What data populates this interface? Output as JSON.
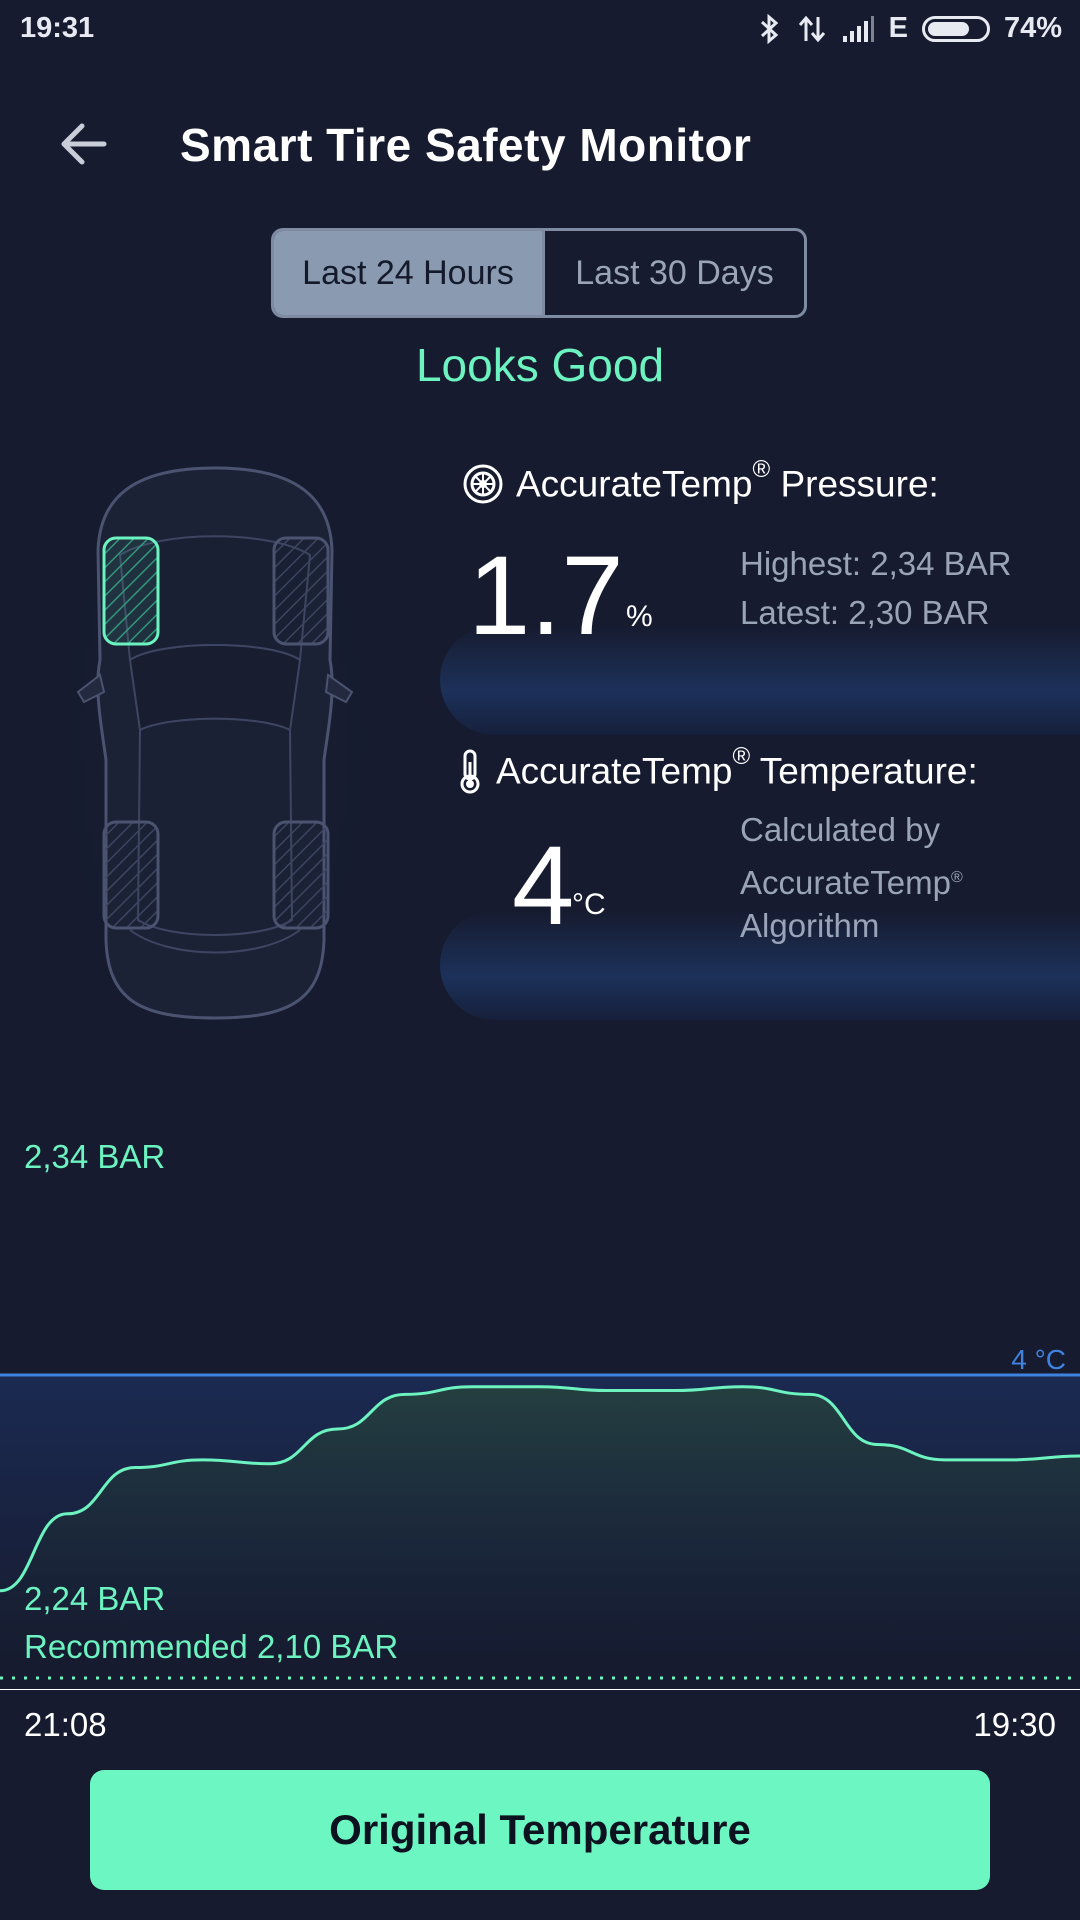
{
  "status_bar": {
    "time": "19:31",
    "network": "E",
    "battery_percent": "74%",
    "battery_level": 0.74,
    "icons": [
      "bluetooth-icon",
      "data-transfer-icon",
      "signal-icon",
      "battery-icon"
    ]
  },
  "header": {
    "title": "Smart Tire Safety Monitor",
    "back_icon": "back-arrow-icon"
  },
  "tabs": [
    {
      "label": "Last 24 Hours",
      "active": true
    },
    {
      "label": "Last 30 Days",
      "active": false
    }
  ],
  "status_message": "Looks Good",
  "selected_tire": "front-left",
  "pressure": {
    "title": "AccurateTemp",
    "title_suffix": " Pressure:",
    "registered": "®",
    "value": "1.7",
    "unit": "%",
    "highest": "Highest: 2,34 BAR",
    "latest": "Latest: 2,30 BAR"
  },
  "temperature": {
    "title": "AccurateTemp",
    "title_suffix": " Temperature:",
    "registered": "®",
    "value": "4",
    "unit": "°C",
    "note_line1": "Calculated by",
    "note_line2": "AccurateTemp",
    "note_line3": "Algorithm"
  },
  "chart_labels": {
    "max": "2,34 BAR",
    "temp": "4 °C",
    "min": "2,24 BAR",
    "recommended": "Recommended 2,10 BAR",
    "start_time": "21:08",
    "end_time": "19:30"
  },
  "chart_data": {
    "type": "line",
    "x": [
      "21:08",
      "19:30"
    ],
    "series": [
      {
        "values": [
          2.245,
          2.265,
          2.277,
          2.279,
          2.278,
          2.287,
          2.296,
          2.298,
          2.298,
          2.297,
          2.297,
          2.298,
          2.296,
          2.283,
          2.279,
          2.279,
          2.28
        ]
      }
    ],
    "ylim": [
      2.24,
      2.34
    ],
    "reference_line": 2.1,
    "accent_color": "#6cf3c0",
    "temp_line_color": "#3f82e0"
  },
  "button": {
    "label": "Original Temperature"
  },
  "colors": {
    "background": "#161b2f",
    "accent": "#6cf3c0",
    "button": "#6cf7c2"
  }
}
